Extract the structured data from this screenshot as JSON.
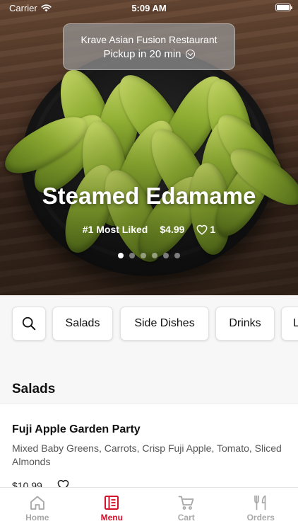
{
  "status_bar": {
    "carrier": "Carrier",
    "time": "5:09 AM"
  },
  "restaurant": {
    "name": "Krave Asian Fusion Restaurant",
    "pickup": "Pickup in 20 min"
  },
  "featured": {
    "title": "Steamed Edamame",
    "rank": "#1 Most Liked",
    "price": "$4.99",
    "likes": "1",
    "slide_count": 6,
    "active_slide": 1
  },
  "categories": [
    "Salads",
    "Side Dishes",
    "Drinks",
    "L"
  ],
  "menu": {
    "section_title": "Salads",
    "items": [
      {
        "name": "Fuji Apple Garden Party",
        "description": "Mixed Baby Greens, Carrots, Crisp Fuji Apple, Tomato, Sliced Almonds",
        "price": "$10.99"
      }
    ]
  },
  "tabs": [
    {
      "label": "Home",
      "icon": "home-icon"
    },
    {
      "label": "Menu",
      "icon": "menu-icon",
      "active": true
    },
    {
      "label": "Cart",
      "icon": "cart-icon"
    },
    {
      "label": "Orders",
      "icon": "fork-knife-icon"
    }
  ],
  "colors": {
    "accent": "#d0122a",
    "inactive_tab": "#a8a8a8",
    "background": "#f7f7f7"
  }
}
